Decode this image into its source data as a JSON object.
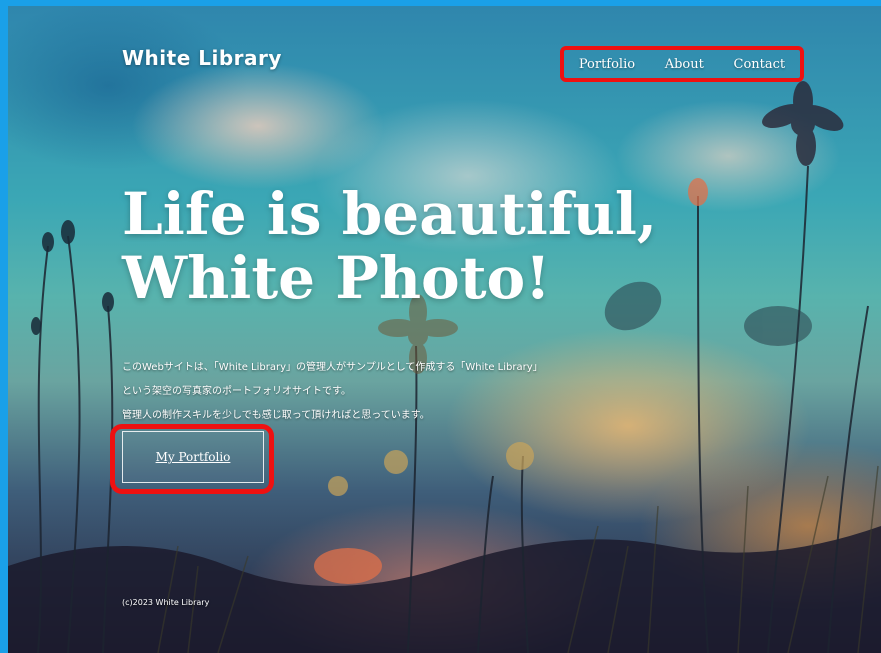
{
  "site": {
    "logo": "White Library"
  },
  "nav": {
    "items": [
      {
        "label": "Portfolio"
      },
      {
        "label": "About"
      },
      {
        "label": "Contact"
      }
    ]
  },
  "hero": {
    "title_line1": "Life is beautiful,",
    "title_line2": "White Photo!",
    "description": [
      "このWebサイトは、「White Library」の管理人がサンプルとして作成する「White Library」",
      "という架空の写真家のポートフォリオサイトです。",
      "管理人の制作スキルを少しでも感じ取って頂ければと思っています。"
    ],
    "button_label": "My Portfolio"
  },
  "footer": {
    "copyright": "(c)2023 White Library"
  },
  "colors": {
    "frame_border": "#1aa0e8",
    "highlight": "#ee1111",
    "text": "#ffffff"
  }
}
